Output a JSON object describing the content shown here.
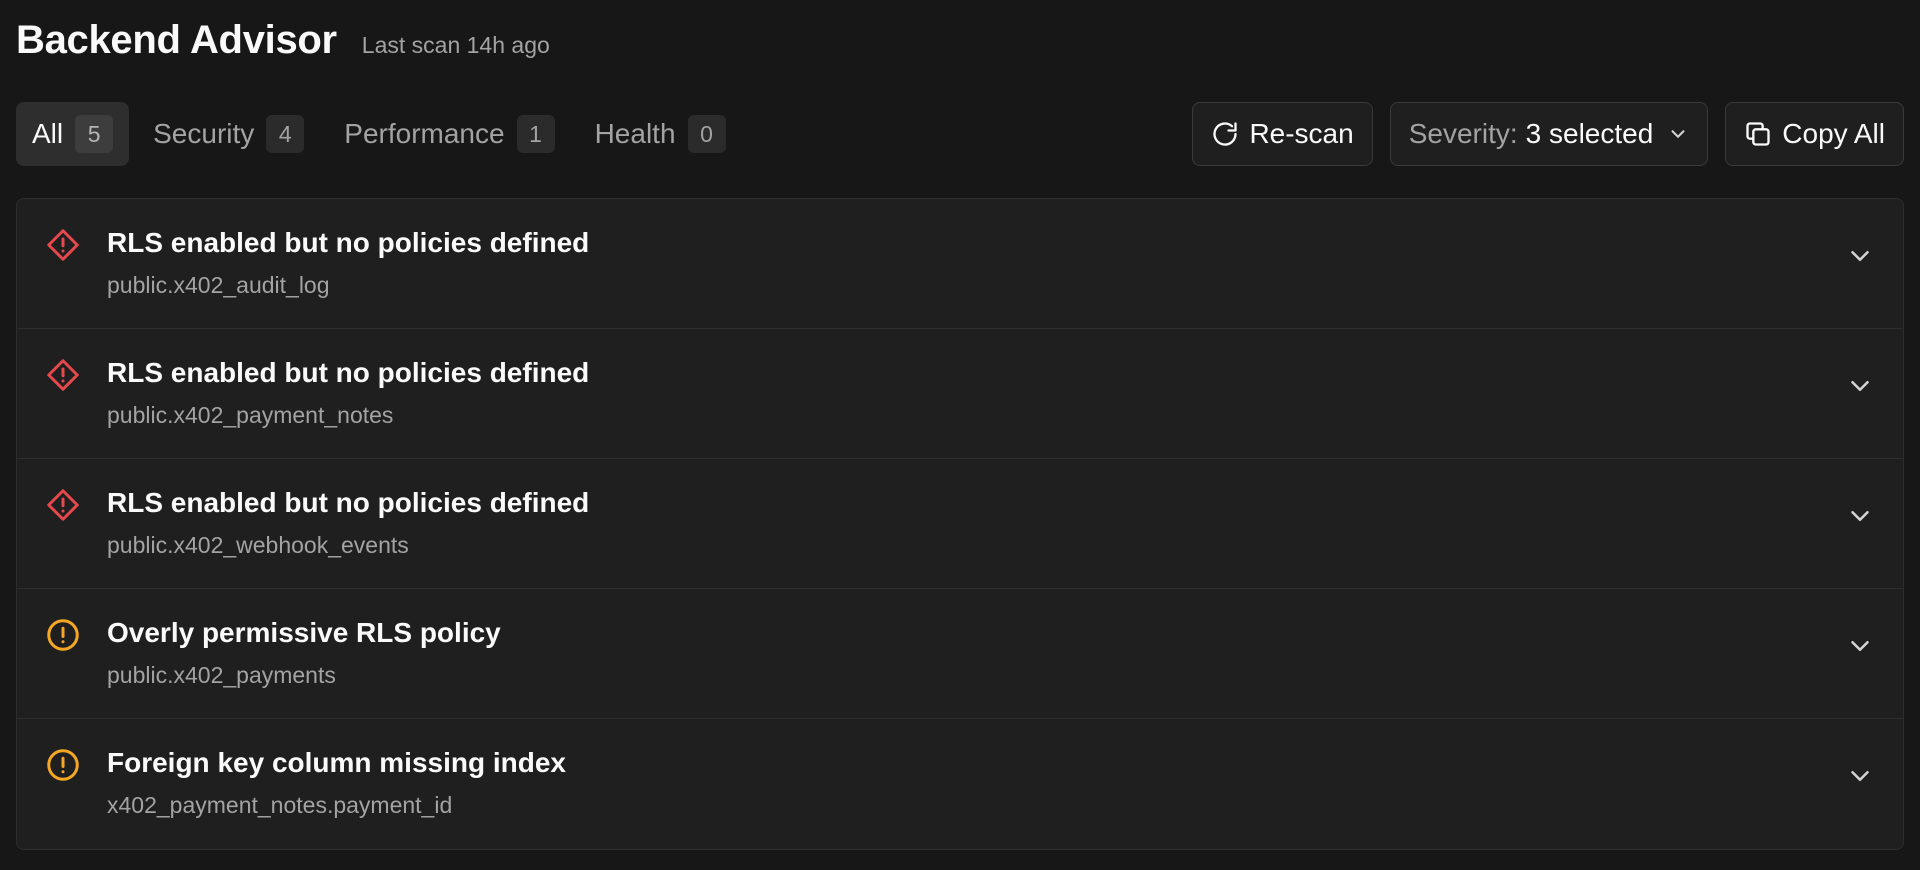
{
  "header": {
    "title": "Backend Advisor",
    "last_scan": "Last scan 14h ago"
  },
  "tabs": [
    {
      "label": "All",
      "count": "5",
      "active": true
    },
    {
      "label": "Security",
      "count": "4",
      "active": false
    },
    {
      "label": "Performance",
      "count": "1",
      "active": false
    },
    {
      "label": "Health",
      "count": "0",
      "active": false
    }
  ],
  "actions": {
    "rescan_label": "Re-scan",
    "severity_label": "Severity:",
    "severity_value": "3 selected",
    "copy_all_label": "Copy All"
  },
  "findings": [
    {
      "title": "RLS enabled but no policies defined",
      "target": "public.x402_audit_log",
      "severity": "error",
      "icon": "alert-diamond-icon"
    },
    {
      "title": "RLS enabled but no policies defined",
      "target": "public.x402_payment_notes",
      "severity": "error",
      "icon": "alert-diamond-icon"
    },
    {
      "title": "RLS enabled but no policies defined",
      "target": "public.x402_webhook_events",
      "severity": "error",
      "icon": "alert-diamond-icon"
    },
    {
      "title": "Overly permissive RLS policy",
      "target": "public.x402_payments",
      "severity": "warning",
      "icon": "alert-circle-icon"
    },
    {
      "title": "Foreign key column missing index",
      "target": "x402_payment_notes.payment_id",
      "severity": "warning",
      "icon": "alert-circle-icon"
    }
  ],
  "colors": {
    "error": "#e5484d",
    "warning": "#f5a623",
    "background": "#171717",
    "surface": "#1f1f1f",
    "border": "#2e2e2e"
  }
}
